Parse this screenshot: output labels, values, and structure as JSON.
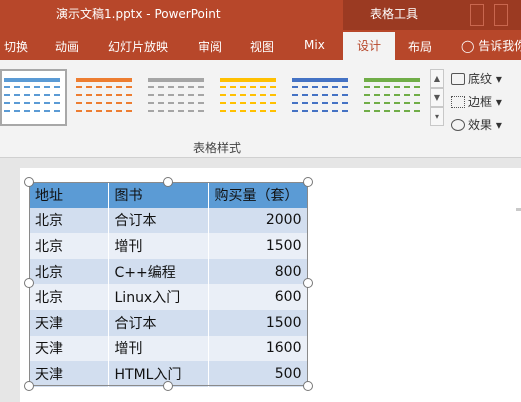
{
  "window": {
    "title": "演示文稿1.pptx - PowerPoint",
    "context_group": "表格工具"
  },
  "tabs": [
    {
      "label": "切换"
    },
    {
      "label": "动画"
    },
    {
      "label": "幻灯片放映"
    },
    {
      "label": "审阅"
    },
    {
      "label": "视图"
    },
    {
      "label": "Mix"
    },
    {
      "label": "设计",
      "active": true
    },
    {
      "label": "布局"
    }
  ],
  "tell_me": "告诉我你想要做什么",
  "ribbon": {
    "group_label": "表格样式",
    "style_swatches": [
      "#5b9bd5",
      "#ed7d31",
      "#a5a5a5",
      "#ffc000",
      "#4472c4",
      "#70ad47"
    ],
    "commands": [
      {
        "label": "底纹",
        "icon": "paint-bucket-icon"
      },
      {
        "label": "边框",
        "icon": "borders-icon"
      },
      {
        "label": "效果",
        "icon": "effects-icon"
      }
    ]
  },
  "table": {
    "headers": [
      "地址",
      "图书",
      "购买量（套）"
    ],
    "rows": [
      [
        "北京",
        "合订本",
        "2000"
      ],
      [
        "北京",
        "增刊",
        "1500"
      ],
      [
        "北京",
        "C++编程",
        "800"
      ],
      [
        "北京",
        "Linux入门",
        "600"
      ],
      [
        "天津",
        "合订本",
        "1500"
      ],
      [
        "天津",
        "增刊",
        "1600"
      ],
      [
        "天津",
        "HTML入门",
        "500"
      ]
    ]
  },
  "colors": {
    "accent": "#b7472a",
    "table_header": "#5b9bd5",
    "table_band_dark": "#d2deef",
    "table_band_light": "#eaeff7"
  }
}
